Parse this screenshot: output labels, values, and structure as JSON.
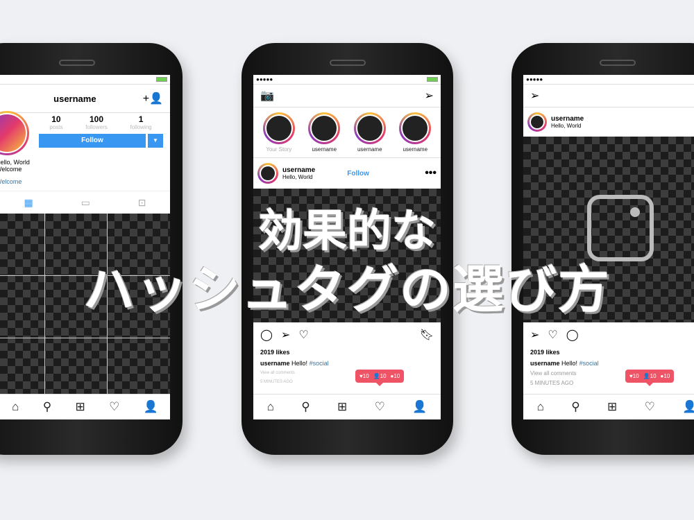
{
  "profile_phone": {
    "username": "username",
    "stats": [
      {
        "value": "10",
        "label": "posts"
      },
      {
        "value": "100",
        "label": "followers"
      },
      {
        "value": "1",
        "label": "following"
      }
    ],
    "follow_label": "Follow",
    "bio_line1": "Hello, World",
    "bio_line2": "Welcome",
    "bio_link": "Welcome"
  },
  "feed_phone": {
    "stories": [
      "Your Story",
      "username",
      "username",
      "username"
    ],
    "post_user": "username",
    "post_sub": "Hello, World",
    "follow_label": "Follow",
    "likes": "2019 likes",
    "caption_user": "username",
    "caption_text": "Hello!",
    "hashtag": "#social",
    "view_comments": "View all comments",
    "time": "5 MINUTES AGO",
    "badge": [
      "10",
      "10",
      "10"
    ]
  },
  "post_phone": {
    "post_user": "username",
    "post_sub": "Hello, World",
    "likes": "2019 likes",
    "caption_user": "username",
    "caption_text": "Hello!",
    "hashtag": "#social",
    "view_comments": "View all comments",
    "time": "5 MINUTES AGO",
    "badge": [
      "10",
      "10",
      "10"
    ]
  },
  "headline": {
    "line1": "効果的な",
    "line2": "ハッシュタグの選び方"
  },
  "colors": {
    "follow": "#3897f0",
    "badge": "#ef5466",
    "hashtag": "#3f729b"
  }
}
